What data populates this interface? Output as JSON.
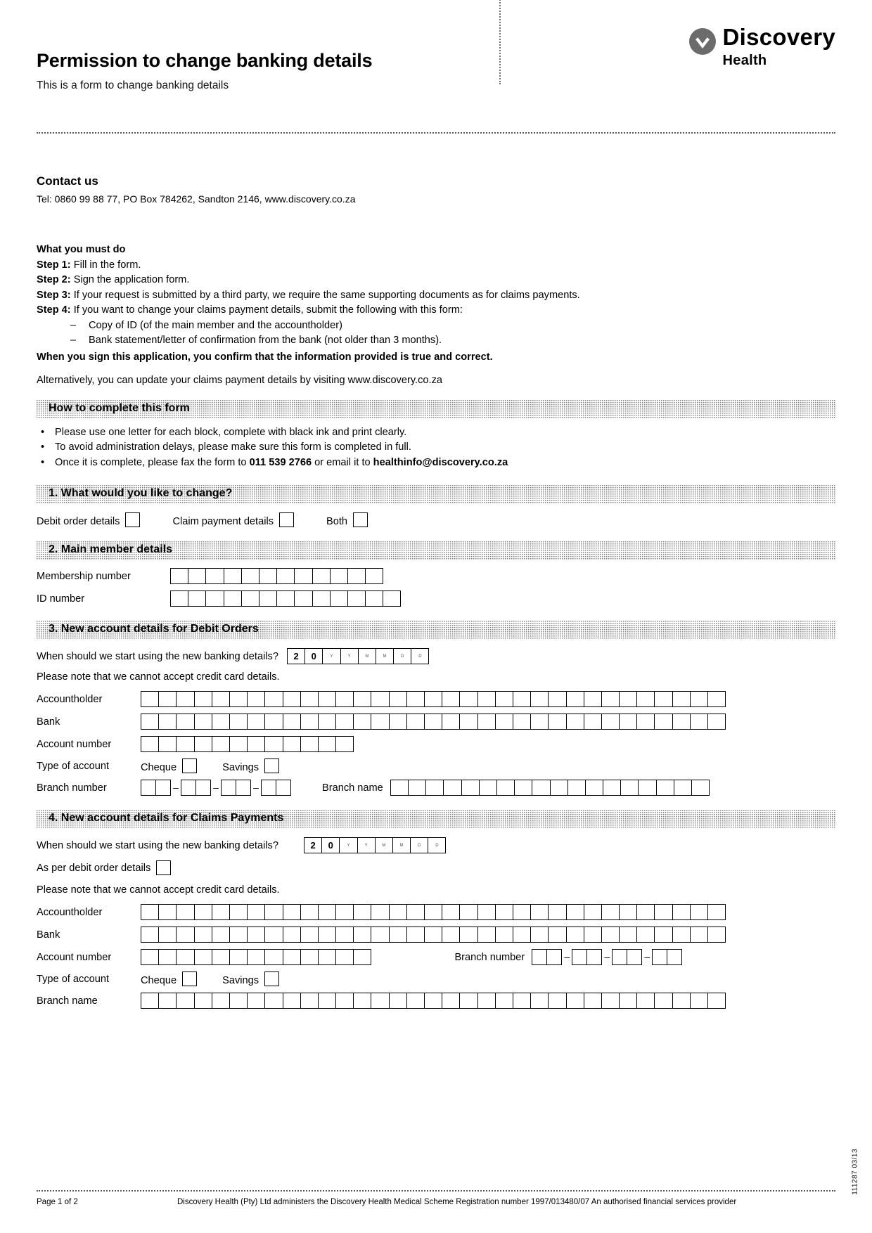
{
  "header": {
    "title": "Permission to change banking details",
    "subtitle": "This is a form to change banking details",
    "logo_name": "Discovery",
    "logo_sub": "Health"
  },
  "contact": {
    "heading": "Contact us",
    "details": "Tel: 0860 99 88 77, PO Box 784262, Sandton 2146, www.discovery.co.za"
  },
  "must_do": {
    "heading": "What you must do",
    "steps": [
      {
        "label": "Step 1:",
        "text": "Fill in the form."
      },
      {
        "label": "Step 2:",
        "text": "Sign the application form."
      },
      {
        "label": "Step 3:",
        "text": "If your request is submitted by a third party, we require the same supporting documents as for claims payments."
      },
      {
        "label": "Step 4:",
        "text": "If you want to change your claims payment details, submit the following with this form:"
      }
    ],
    "sub_items": [
      "Copy of ID (of the main member and the accountholder)",
      "Bank statement/letter of confirmation from the bank (not older than 3 months)."
    ],
    "dash": "–",
    "confirm_line": "When you sign this application, you confirm that the information provided is true and correct.",
    "alternative_line": "Alternatively, you can update your claims payment details by visiting www.discovery.co.za"
  },
  "how_to": {
    "heading": "How to complete this form",
    "bullets": [
      {
        "pre": "Please use one letter for each block, complete with black ink and print clearly.",
        "bold": "",
        "post": ""
      },
      {
        "pre": "To avoid administration delays, please make sure this form is completed in full.",
        "bold": "",
        "post": ""
      },
      {
        "pre": "Once it is complete, please fax the form to ",
        "bold": "011 539 2766",
        "post": " or email it to ",
        "bold2": "healthinfo@discovery.co.za"
      }
    ]
  },
  "section1": {
    "heading": "1. What would you like to change?",
    "options": [
      "Debit order details",
      "Claim payment details",
      "Both"
    ]
  },
  "section2": {
    "heading": "2. Main member details",
    "rows": [
      {
        "label": "Membership number",
        "cells": 12
      },
      {
        "label": "ID number",
        "cells": 13
      }
    ]
  },
  "section3": {
    "heading": "3. New account details for Debit Orders",
    "date_question": "When should we start using the new banking details?",
    "date_prefix": [
      "2",
      "0"
    ],
    "date_hints": [
      "Y",
      "Y",
      "M",
      "M",
      "D",
      "D"
    ],
    "credit_card_note": "Please note that we cannot accept credit card details.",
    "accountholder_label": "Accountholder",
    "accountholder_cells": 33,
    "bank_label": "Bank",
    "bank_cells": 33,
    "account_number_label": "Account number",
    "account_number_cells": 12,
    "type_label": "Type of account",
    "type_options": [
      "Cheque",
      "Savings"
    ],
    "branch_number_label": "Branch number",
    "branch_number_groups": [
      2,
      2,
      2,
      2
    ],
    "branch_name_label": "Branch name",
    "branch_name_cells": 18
  },
  "section4": {
    "heading": "4. New account details for Claims Payments",
    "date_question": "When should we start using the new banking details?",
    "date_prefix": [
      "2",
      "0"
    ],
    "date_hints": [
      "Y",
      "Y",
      "M",
      "M",
      "D",
      "D"
    ],
    "as_per_debit_label": "As per debit order details",
    "credit_card_note": "Please note that we cannot accept credit card details.",
    "accountholder_label": "Accountholder",
    "accountholder_cells": 33,
    "bank_label": "Bank",
    "bank_cells": 33,
    "account_number_label": "Account number",
    "account_number_cells": 13,
    "branch_number_label": "Branch number",
    "branch_number_groups": [
      2,
      2,
      2,
      2
    ],
    "type_label": "Type of account",
    "type_options": [
      "Cheque",
      "Savings"
    ],
    "branch_name_label": "Branch name",
    "branch_name_cells": 33
  },
  "footer": {
    "page": "Page 1 of 2",
    "text": "Discovery Health (Pty) Ltd administers the Discovery Health Medical Scheme   Registration number 1997/013480/07  An authorised financial services provider",
    "side_code": "111287 03/13"
  }
}
